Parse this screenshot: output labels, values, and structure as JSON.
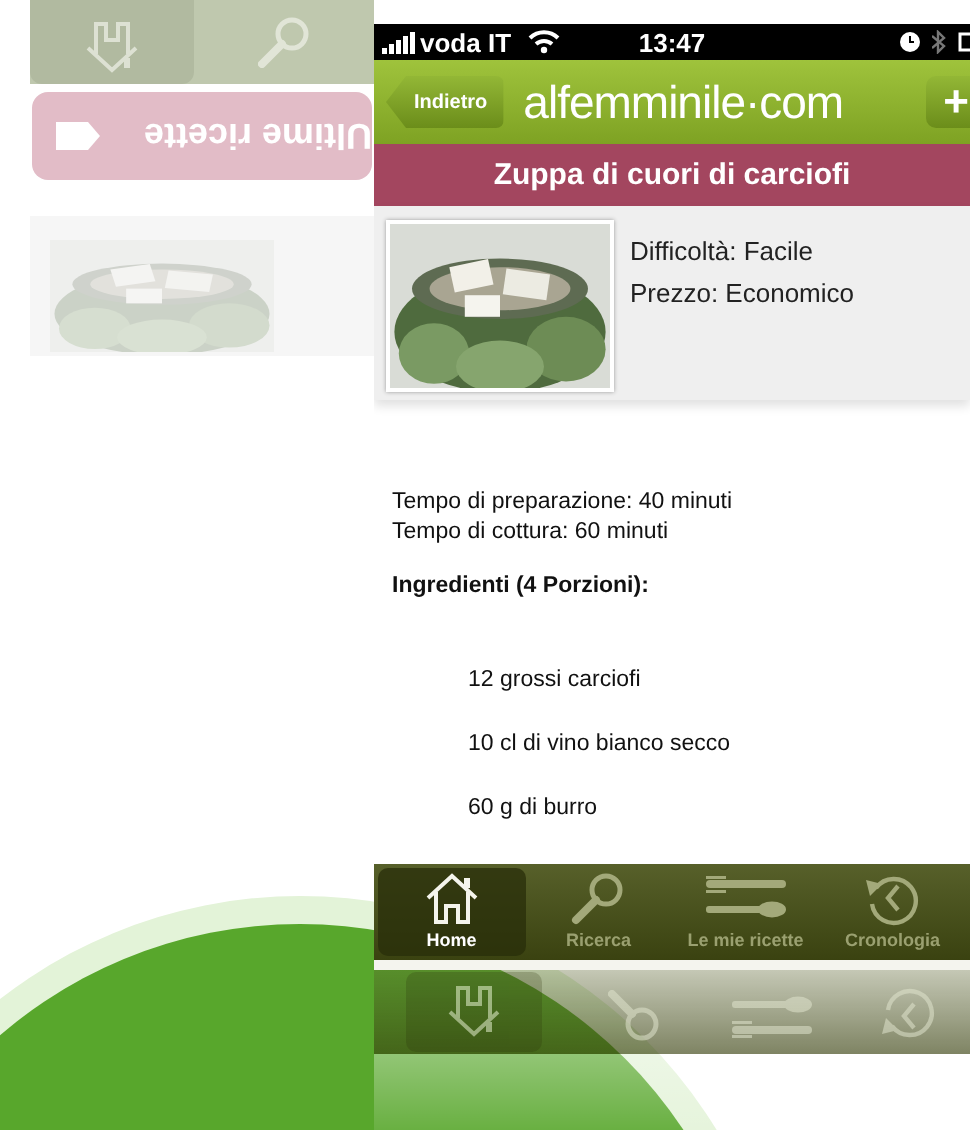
{
  "backdrop": {
    "menu_button": "Ultime ricette",
    "card_photo": {
      "kind": "picture"
    }
  },
  "status_bar": {
    "carrier": "voda IT",
    "time": "13:47"
  },
  "nav_bar": {
    "back_button": "Indietro",
    "logo": "alfemminile·com",
    "add_button": "+"
  },
  "recipe": {
    "title": "Zuppa di cuori di carciofi",
    "photo": {
      "kind": "picture"
    },
    "details": [
      "Difficoltà: Facile",
      "Prezzo: Economico"
    ],
    "times": [
      "Tempo di preparazione: 40 minuti",
      "Tempo di cottura: 60 minuti"
    ],
    "ingredients_heading": "Ingredienti (4 Porzioni):",
    "ingredients": [
      "12 grossi carciofi",
      "10 cl di vino bianco secco",
      "60 g di burro"
    ]
  },
  "tab_bar": [
    {
      "label": "Home",
      "selected": true
    },
    {
      "label": "Ricerca",
      "selected": false
    },
    {
      "label": "Le mie ricette",
      "selected": false
    },
    {
      "label": "Cronologia",
      "selected": false
    }
  ]
}
